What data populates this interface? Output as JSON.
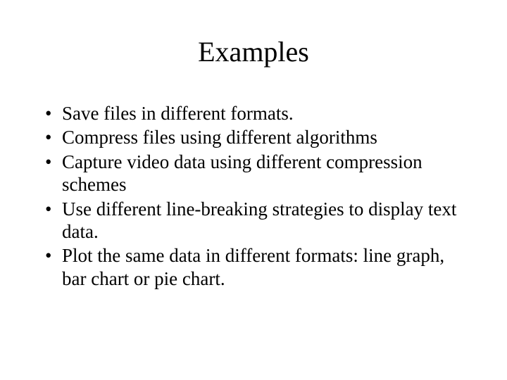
{
  "title": "Examples",
  "bullets": {
    "item0": "Save files in different formats.",
    "item1": "Compress files using different algorithms",
    "item2": "Capture video data using different compression schemes",
    "item3": "Use different line-breaking strategies to display text data.",
    "item4": "Plot the same data in different formats: line graph, bar chart or pie chart."
  }
}
